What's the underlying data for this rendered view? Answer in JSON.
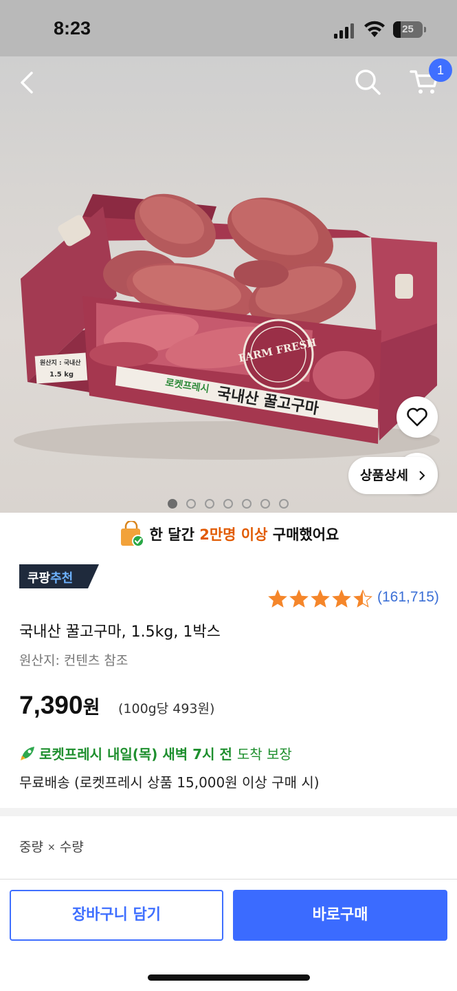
{
  "status_bar": {
    "time": "8:23",
    "battery_level": "25"
  },
  "header": {
    "cart_count": "1"
  },
  "hero": {
    "box_brand_text": "로켓프레시",
    "box_product_text": "국내산 꿀고구마",
    "box_origin_text": "원산지 : 국내산",
    "box_weight_text": "1.5 kg",
    "box_seal_text": "FARM FRESH",
    "detail_button_label": "상품상세",
    "image_count": 7,
    "active_image_index": 0
  },
  "purchase_banner": {
    "prefix": "한 달간",
    "highlight": "2만명 이상",
    "suffix": "구매했어요"
  },
  "recommend_badge": {
    "brand": "쿠팡",
    "label": "추천"
  },
  "rating": {
    "stars": 4.5,
    "review_count": "(161,715)"
  },
  "product": {
    "title": "국내산 꿀고구마, 1.5kg, 1박스",
    "origin": "원산지: 컨텐츠 참조",
    "price": "7,390",
    "price_unit": "원",
    "unit_price": "(100g당 493원)"
  },
  "delivery": {
    "bold_text": "로켓프레시 내일(목) 새벽 7시 전",
    "light_text": "도착 보장",
    "free_shipping": "무료배송 (로켓프레시 상품 15,000원 이상 구매 시)"
  },
  "option": {
    "weight": "중량",
    "sep": "×",
    "quantity": "수량"
  },
  "buttons": {
    "add_to_cart": "장바구니 담기",
    "buy_now": "바로구매"
  },
  "colors": {
    "accent": "#3b6bff",
    "highlight": "#e15a00",
    "delivery": "#1e8f2e",
    "star": "#f5862a",
    "box": "#9c2f48"
  }
}
